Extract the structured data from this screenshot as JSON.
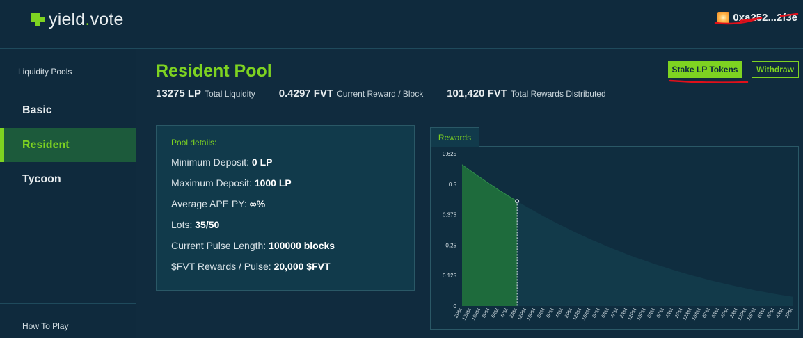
{
  "header": {
    "logo_left": "yield",
    "logo_dot": ".",
    "logo_right": "vote",
    "wallet_address": "0xa252...2f3e"
  },
  "sidebar": {
    "heading": "Liquidity Pools",
    "items": [
      {
        "label": "Basic",
        "active": false
      },
      {
        "label": "Resident",
        "active": true
      },
      {
        "label": "Tycoon",
        "active": false
      }
    ],
    "footer": "How To Play"
  },
  "pool": {
    "title": "Resident Pool",
    "stats": [
      {
        "value": "13275 LP",
        "label": "Total Liquidity"
      },
      {
        "value": "0.4297 FVT",
        "label": "Current Reward / Block"
      },
      {
        "value": "101,420 FVT",
        "label": "Total Rewards Distributed"
      }
    ],
    "stake_label": "Stake LP Tokens",
    "withdraw_label": "Withdraw"
  },
  "details": {
    "title": "Pool details:",
    "rows": [
      {
        "label": "Minimum Deposit:",
        "value": "0 LP"
      },
      {
        "label": "Maximum Deposit:",
        "value": "1000 LP"
      },
      {
        "label": "Average APE PY:",
        "value": "∞%"
      },
      {
        "label": "Lots:",
        "value": "35/50"
      },
      {
        "label": "Current Pulse Length:",
        "value": "100000 blocks"
      },
      {
        "label": "$FVT Rewards / Pulse:",
        "value": "20,000 $FVT"
      }
    ]
  },
  "colors": {
    "accent": "#7ed321",
    "background": "#102b3e",
    "panel": "#113a4b",
    "annotation_red": "#e0101a"
  },
  "chart_data": {
    "type": "area",
    "tab_label": "Rewards",
    "ylim": [
      0,
      0.625
    ],
    "y_ticks": [
      "0",
      "0.125",
      "0.25",
      "0.375",
      "0.5",
      "0.625"
    ],
    "x_labels": [
      "2PM",
      "12AM",
      "10AM",
      "8PM",
      "6AM",
      "4PM",
      "2AM",
      "12PM",
      "10PM",
      "8AM",
      "6PM",
      "4AM",
      "2PM",
      "12AM",
      "10AM",
      "8PM",
      "6AM",
      "4PM",
      "2AM",
      "12PM",
      "10PM",
      "8AM",
      "6PM",
      "4AM",
      "2PM",
      "12AM",
      "10AM",
      "8PM",
      "6AM",
      "4PM",
      "2AM",
      "12PM",
      "10PM",
      "8AM",
      "6PM",
      "4AM",
      "2PM"
    ],
    "series": [
      {
        "values": [
          0.58,
          0.553,
          0.527,
          0.501,
          0.476,
          0.453,
          0.43,
          0.408,
          0.387,
          0.366,
          0.346,
          0.327,
          0.309,
          0.291,
          0.274,
          0.258,
          0.242,
          0.227,
          0.212,
          0.198,
          0.185,
          0.172,
          0.16,
          0.148,
          0.137,
          0.126,
          0.116,
          0.106,
          0.097,
          0.088,
          0.08,
          0.072,
          0.064,
          0.057,
          0.05,
          0.044,
          0.038
        ]
      }
    ],
    "highlight_until_index": 6,
    "highlight_value": 0.4297
  }
}
